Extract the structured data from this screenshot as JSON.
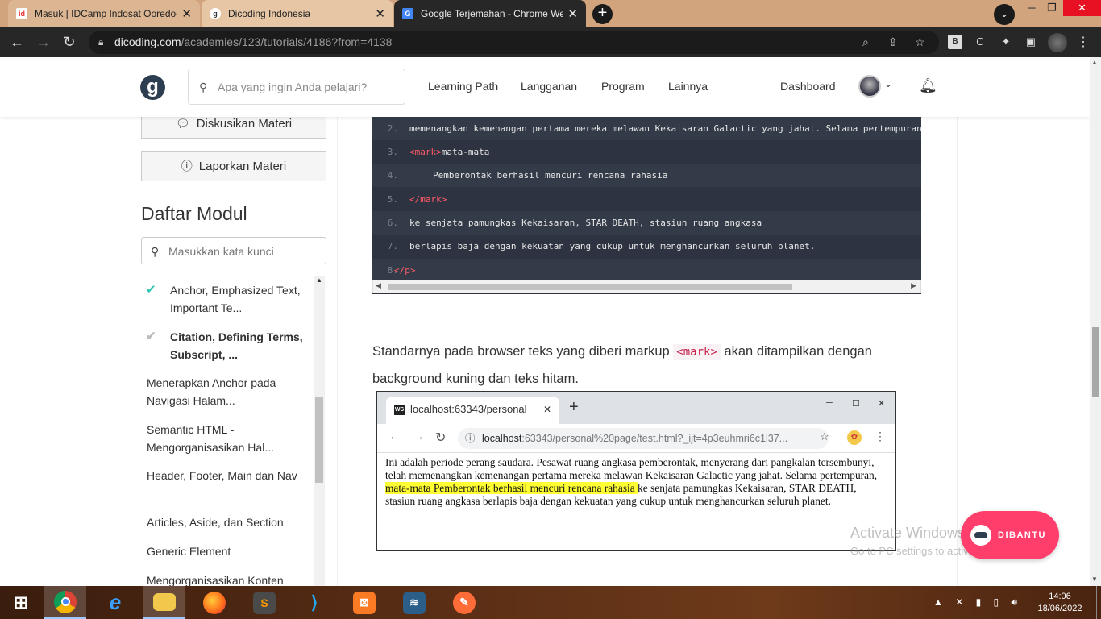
{
  "browser": {
    "tabs": [
      {
        "title": "Masuk | IDCamp Indosat Ooredoo",
        "favicon": "idcamp-icon",
        "close": "✕"
      },
      {
        "title": "Dicoding Indonesia",
        "favicon": "dicoding-icon",
        "close": "✕"
      },
      {
        "title": "Google Terjemahan - Chrome Web",
        "favicon": "google-translate-icon",
        "close": "✕"
      }
    ],
    "new_tab": "+",
    "url_host": "dicoding.com",
    "url_path": "/academies/123/tutorials/4186?from=4138",
    "ext_b": "B"
  },
  "header": {
    "logo": "g",
    "search_placeholder": "Apa yang ingin Anda pelajari?",
    "nav": [
      "Learning Path",
      "Langganan",
      "Program",
      "Lainnya"
    ],
    "dashboard": "Dashboard"
  },
  "sidebar": {
    "diskusi": "Diskusikan Materi",
    "laporkan": "Laporkan Materi",
    "modul_title": "Daftar Modul",
    "modul_search_placeholder": "Masukkan kata kunci",
    "items": [
      {
        "label": "Anchor, Emphasized Text, Important Te...",
        "status": "done"
      },
      {
        "label": "Citation, Defining Terms, Subscript, ...",
        "status": "current"
      },
      {
        "label": "Menerapkan Anchor pada Navigasi Halam...",
        "status": "none"
      },
      {
        "label": "Semantic HTML - Mengorganisasikan Hal...",
        "status": "none"
      },
      {
        "label": "Header, Footer, Main dan Nav",
        "status": "none"
      },
      {
        "label": "Articles, Aside, dan Section",
        "status": "none"
      },
      {
        "label": "Generic Element",
        "status": "none"
      },
      {
        "label": "Mengorganisasikan Konten",
        "status": "none"
      }
    ]
  },
  "code": {
    "lines": [
      {
        "n": "2.",
        "pre": "",
        "tag": "",
        "text": "memenangkan kemenangan pertama mereka melawan Kekaisaran Galactic yang jahat. Selama pertempuran,"
      },
      {
        "n": "3.",
        "pre": "",
        "tag": "<mark>",
        "text": "mata-mata"
      },
      {
        "n": "4.",
        "pre": "    ",
        "tag": "",
        "text": "Pemberontak berhasil mencuri rencana rahasia"
      },
      {
        "n": "5.",
        "pre": "",
        "tag": "</mark>",
        "text": ""
      },
      {
        "n": "6.",
        "pre": "",
        "tag": "",
        "text": "ke senjata pamungkas Kekaisaran, STAR DEATH, stasiun ruang angkasa"
      },
      {
        "n": "7.",
        "pre": "",
        "tag": "",
        "text": "berlapis baja dengan kekuatan yang cukup untuk menghancurkan seluruh planet."
      },
      {
        "n": "8.",
        "pre": "",
        "tag": "</p>",
        "text": ""
      }
    ]
  },
  "article": {
    "para_before": "Standarnya pada browser teks yang diberi markup ",
    "para_code": "<mark>",
    "para_after": " akan ditampilkan dengan background kuning dan teks hitam."
  },
  "screenshot": {
    "tab_title": "localhost:63343/personal",
    "tab_fav": "WS",
    "url_host": "localhost",
    "url_rest": ":63343/personal%20page/test.html?_ijt=4p3euhmri6c1l37...",
    "text_before": "Ini adalah periode perang saudara. Pesawat ruang angkasa pemberontak, menyerang dari pangkalan tersembunyi, telah memenangkan kemenangan pertama mereka melawan Kekaisaran Galactic yang jahat. Selama pertempuran, ",
    "text_mark": "mata-mata Pemberontak berhasil mencuri rencana rahasia ",
    "text_after": "ke senjata pamungkas Kekaisaran, STAR DEATH, stasiun ruang angkasa berlapis baja dengan kekuatan yang cukup untuk menghancurkan seluruh planet."
  },
  "watermark": {
    "line1": "Activate Windows",
    "line2": "Go to PC settings to activate Windows."
  },
  "dibantu": "DIBANTU",
  "taskbar": {
    "apps": [
      "windows-start",
      "chrome",
      "internet-explorer",
      "file-explorer",
      "firefox",
      "sublime-text",
      "vscode",
      "xampp",
      "mysql-workbench",
      "postman"
    ],
    "time": "14:06",
    "date": "18/06/2022"
  },
  "colors": {
    "accent": "#ff3e6c",
    "code_bg": "#2d3340",
    "mark_bg": "#ffff33",
    "check": "#2cc6b2"
  }
}
